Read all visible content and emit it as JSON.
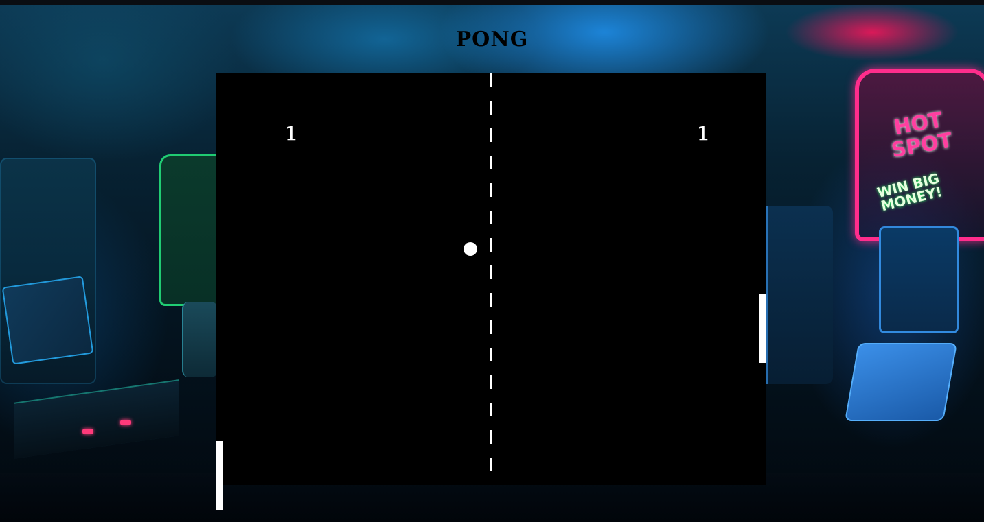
{
  "title": "PONG",
  "game": {
    "score_left": "1",
    "score_right": "1",
    "colors": {
      "board": "#000000",
      "foreground": "#ffffff",
      "title": "#000000"
    }
  },
  "background": {
    "cabinet_sign_hot_spot": "HOT SPOT",
    "cabinet_sign_win": "WIN BIG MONEY!"
  }
}
